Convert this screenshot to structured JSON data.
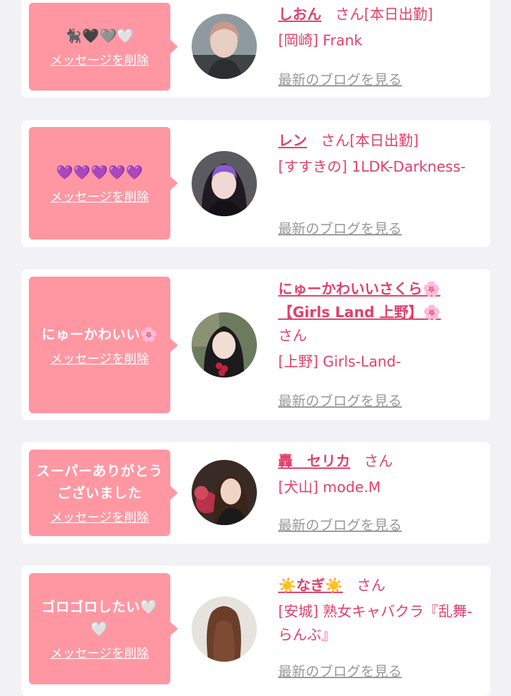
{
  "common": {
    "delete_label": "メッセージを削除",
    "san": "さん",
    "blog_label": "最新のブログを見る"
  },
  "messages": [
    {
      "bubble": "🐈‍⬛🖤🩶🤍",
      "name": "しおん",
      "status": "[本日出勤]",
      "shop": "[岡崎] Frank"
    },
    {
      "bubble": "💜💜💜💜💜",
      "name": "レン",
      "status": "[本日出勤]",
      "shop": "[すすきの] 1LDK-Darkness-"
    },
    {
      "bubble": "にゅーかわいい🌸",
      "name": "にゅーかわいいさくら🌸【Girls Land 上野】🌸",
      "status": "",
      "shop": "[上野] Girls-Land-"
    },
    {
      "bubble": "スーパーありがとうございました",
      "name": "轟　セリカ",
      "status": "",
      "shop": "[犬山] mode.M"
    },
    {
      "bubble": "ゴロゴロしたい🤍🤍",
      "name": "☀️なぎ☀️",
      "status": "",
      "shop": "[安城] 熟女キャバクラ『乱舞-らんぶ』"
    }
  ],
  "colors": {
    "bubble": "#ff97a3",
    "accent_text": "#e2416a",
    "blog_link": "#999999",
    "page_bg": "#f2f2f4",
    "card_bg": "#ffffff"
  }
}
